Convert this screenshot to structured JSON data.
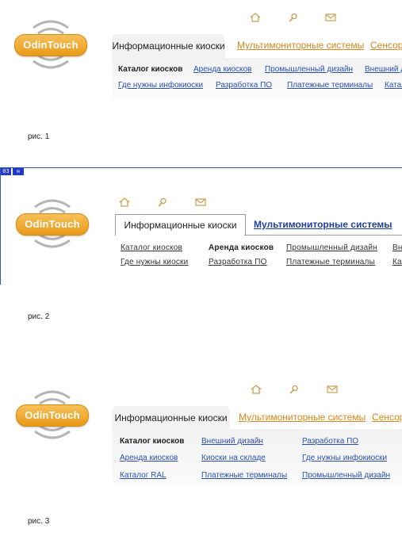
{
  "logo": {
    "text": "OdinTouch",
    "brand_color": "#e99a18"
  },
  "icons": [
    "home-icon",
    "search-icon",
    "mail-icon"
  ],
  "fig1": {
    "tabs": {
      "active": "Информационные киоски",
      "tab2": "Мультимониторные системы",
      "tab3": "Сенсор"
    },
    "row1": [
      "Каталог киосков",
      "Аренда киосков",
      "Промышленный дизайн",
      "Внешний д"
    ],
    "row2": [
      "Где нужны инфокиоски",
      "Разработка ПО",
      "Платежные терминалы",
      "Катал"
    ],
    "caption": "рис. 1"
  },
  "fig2": {
    "badges": [
      "03",
      "✉"
    ],
    "tabs": {
      "active": "Информационные киоски",
      "tab2": "Мультимониторные системы"
    },
    "row1": [
      "Каталог киосков",
      "Аренда киосков",
      "Промышленный дизайн",
      "Вн"
    ],
    "row2": [
      "Где нужны киоски",
      "Разработка ПО",
      "Платежные терминалы",
      "Ка"
    ],
    "caption": "рис. 2"
  },
  "fig3": {
    "tabs": {
      "active": "Информационные киоски",
      "tab2": "Мультимониторные системы",
      "tab3": "Сенсор"
    },
    "col1": [
      "Каталог киосков",
      "Аренда киосков",
      "Каталог RAL"
    ],
    "col2": [
      "Внешний дизайн",
      "Киоски на складе",
      "Платежные терминалы"
    ],
    "col3": [
      "Разработка ПО",
      "Где нужны инфокиоски",
      "Промышленный дизайн"
    ],
    "caption": "рис. 3"
  }
}
